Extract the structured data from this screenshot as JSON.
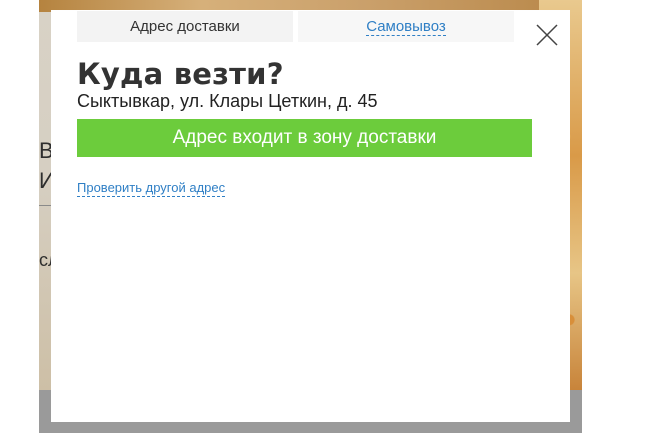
{
  "modal": {
    "tabs": [
      {
        "label": "Адрес доставки",
        "active": true
      },
      {
        "label": "Самовывоз",
        "active": false
      }
    ],
    "heading": "Куда везти?",
    "address": "Сыктывкар, ул. Клары Цеткин, д. 45",
    "status": "Адрес входит в зону доставки",
    "check_other_link": "Проверить другой адрес",
    "close_icon": "close-icon"
  },
  "background": {
    "fragments": [
      "В",
      "И",
      "сл"
    ]
  },
  "colors": {
    "status_green": "#6ccc3c",
    "link_blue": "#2f7fc5",
    "overlay_gray": "#9a9a9a"
  }
}
